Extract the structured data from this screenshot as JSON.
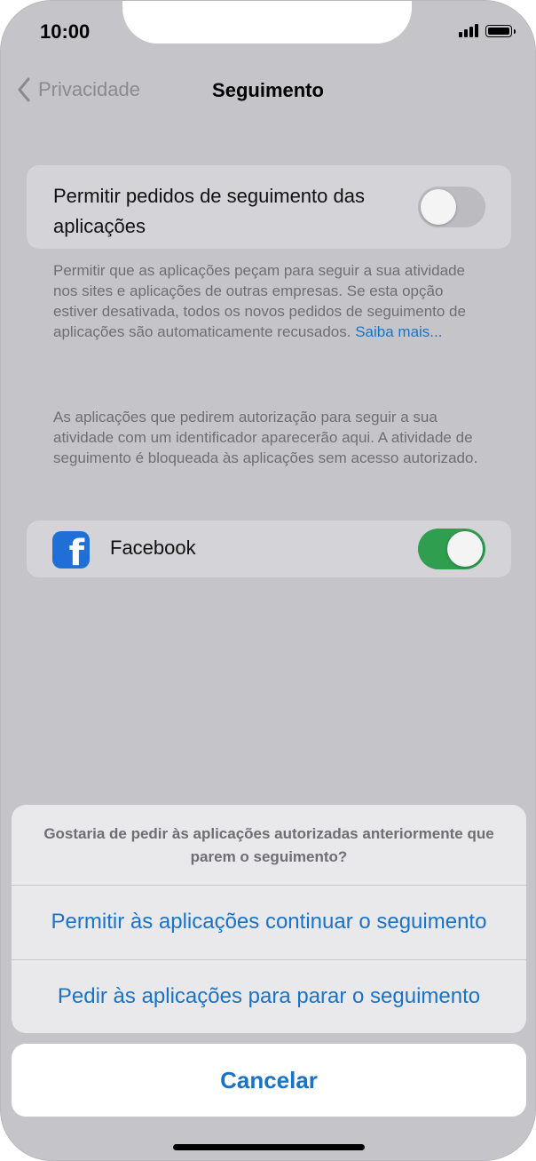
{
  "status_bar": {
    "time": "10:00"
  },
  "nav": {
    "back_label": "Privacidade",
    "title": "Seguimento"
  },
  "tracking_setting": {
    "label": "Permitir pedidos de seguimento das aplicações",
    "enabled": false
  },
  "description": {
    "text": "Permitir que as aplicações peçam para seguir a sua atividade nos sites e aplicações de outras empresas. Se esta opção estiver desativada, todos os novos pedidos de seguimento de aplicações são automaticamente recusados.",
    "link": "Saiba mais..."
  },
  "apps_note": "As aplicações que pedirem autorização para seguir a sua atividade com um identificador aparecerão aqui. A atividade de seguimento é bloqueada às aplicações sem acesso autorizado.",
  "apps": [
    {
      "name": "Facebook",
      "icon": "facebook-icon",
      "enabled": true
    }
  ],
  "action_sheet": {
    "message": "Gostaria de pedir às aplicações autorizadas anteriormente que parem o seguimento?",
    "options": [
      "Permitir às aplicações continuar o seguimento",
      "Pedir às aplicações para parar o seguimento"
    ],
    "cancel": "Cancelar"
  },
  "colors": {
    "accent": "#1a73c6",
    "toggle_on": "#2f9e4f",
    "dim_background": "#c5c5c9"
  }
}
